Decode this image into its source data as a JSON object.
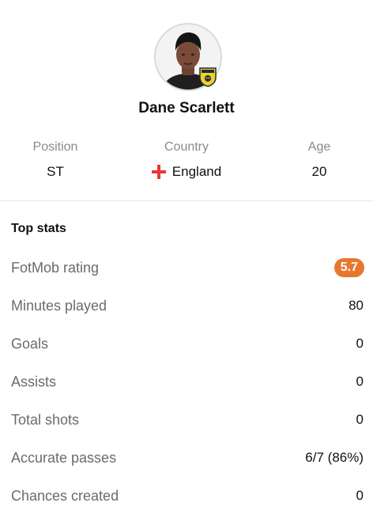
{
  "player": {
    "name": "Dane Scarlett",
    "avatar_icon": "player-photo",
    "club_badge_icon": "oxford-united-badge"
  },
  "info": {
    "position": {
      "label": "Position",
      "value": "ST"
    },
    "country": {
      "label": "Country",
      "value": "England",
      "flag_icon": "england-flag"
    },
    "age": {
      "label": "Age",
      "value": "20"
    }
  },
  "top_stats": {
    "title": "Top stats",
    "rows": [
      {
        "label": "FotMob rating",
        "value": "5.7",
        "badge_color": "#e8772e"
      },
      {
        "label": "Minutes played",
        "value": "80"
      },
      {
        "label": "Goals",
        "value": "0"
      },
      {
        "label": "Assists",
        "value": "0"
      },
      {
        "label": "Total shots",
        "value": "0"
      },
      {
        "label": "Accurate passes",
        "value": "6/7 (86%)"
      },
      {
        "label": "Chances created",
        "value": "0"
      }
    ]
  }
}
